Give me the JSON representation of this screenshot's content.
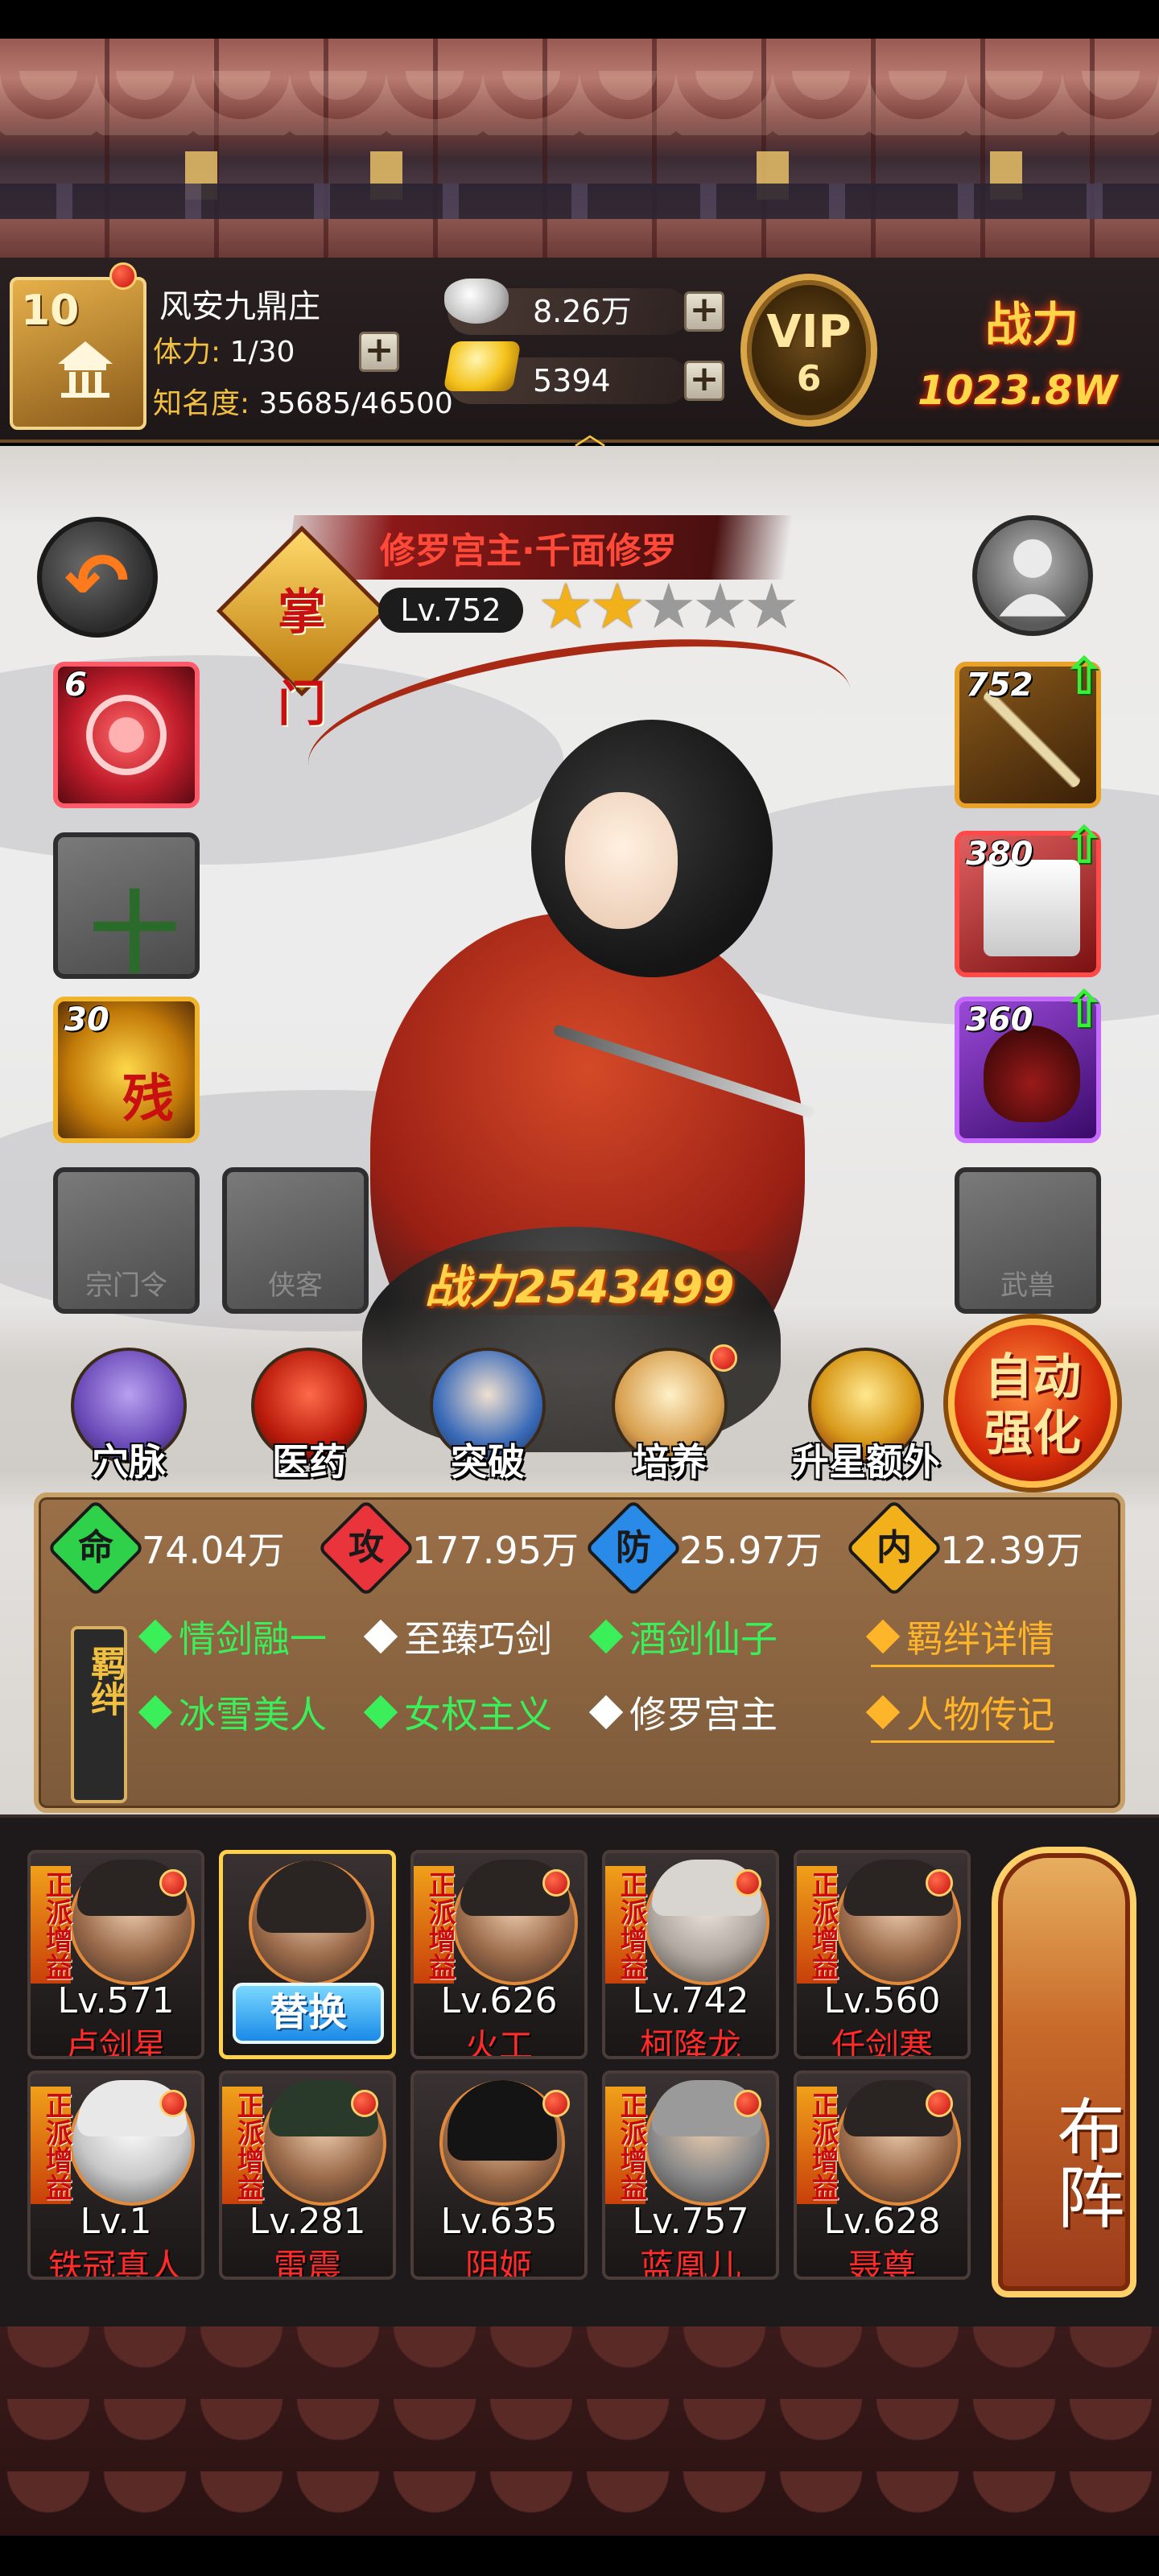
{
  "player": {
    "level": "10",
    "name": "风安九鼎庄",
    "stamina_label": "体力:",
    "stamina_value": "1/30",
    "fame_label": "知名度:",
    "fame_value": "35685/46500",
    "silver": "8.26万",
    "gold": "5394",
    "vip_label": "VIP",
    "vip_level": "6",
    "power_label": "战力",
    "power_value": "1023.8W"
  },
  "hero": {
    "title": "修罗宫主·千面修罗",
    "badge": "掌门",
    "level": "Lv.752",
    "stars_filled": 2,
    "stars_total": 5,
    "power": "战力2543499",
    "left_slots": [
      {
        "level": "6",
        "type": "red-orb"
      },
      {
        "level": "",
        "type": "empty-plus"
      },
      {
        "level": "30",
        "type": "gold-can",
        "mark": "残"
      },
      {
        "level": "",
        "caption": "宗门令"
      },
      {
        "level": "",
        "caption": "侠客"
      }
    ],
    "right_slots": [
      {
        "level": "752",
        "type": "weapon"
      },
      {
        "level": "380",
        "type": "armor"
      },
      {
        "level": "360",
        "type": "treasure"
      },
      {
        "level": "",
        "caption": "武兽"
      }
    ]
  },
  "actions": [
    {
      "label": "穴脉",
      "icon": "meridian-icon"
    },
    {
      "label": "医药",
      "icon": "medicine-icon"
    },
    {
      "label": "突破",
      "icon": "breakthrough-icon"
    },
    {
      "label": "培养",
      "icon": "cultivate-icon"
    },
    {
      "label": "升星额外",
      "icon": "star-upgrade-icon"
    }
  ],
  "auto_button": {
    "line1": "自动",
    "line2": "强化"
  },
  "stats": [
    {
      "key": "命",
      "value": "74.04万",
      "color": "#2fd04a"
    },
    {
      "key": "攻",
      "value": "177.95万",
      "color": "#e8343a"
    },
    {
      "key": "防",
      "value": "25.97万",
      "color": "#2a8ae8"
    },
    {
      "key": "内",
      "value": "12.39万",
      "color": "#f2b01a"
    }
  ],
  "bonds": {
    "label": "羁绊",
    "items": [
      {
        "text": "情剑融一",
        "active": true
      },
      {
        "text": "至臻巧剑",
        "active": false
      },
      {
        "text": "酒剑仙子",
        "active": true
      },
      {
        "text": "冰雪美人",
        "active": true
      },
      {
        "text": "女权主义",
        "active": true
      },
      {
        "text": "修罗宫主",
        "active": false
      }
    ],
    "detail_link": "羁绊详情",
    "bio_link": "人物传记"
  },
  "roster": [
    {
      "level": "Lv.571",
      "name": "卢剑星",
      "tag": "正派增益"
    },
    {
      "level": "",
      "name": "",
      "tag": "",
      "swap": "替换"
    },
    {
      "level": "Lv.626",
      "name": "火工",
      "tag": "正派增益"
    },
    {
      "level": "Lv.742",
      "name": "柯降龙",
      "tag": "正派增益"
    },
    {
      "level": "Lv.560",
      "name": "任剑寒",
      "tag": "正派增益"
    },
    {
      "level": "Lv.1",
      "name": "铁冠真人",
      "tag": "正派增益"
    },
    {
      "level": "Lv.281",
      "name": "雷震",
      "tag": "正派增益"
    },
    {
      "level": "Lv.635",
      "name": "阴姬",
      "tag": ""
    },
    {
      "level": "Lv.757",
      "name": "蓝凰儿",
      "tag": "正派增益"
    },
    {
      "level": "Lv.628",
      "name": "聂尊",
      "tag": "正派增益"
    }
  ],
  "formation_button": "布阵"
}
